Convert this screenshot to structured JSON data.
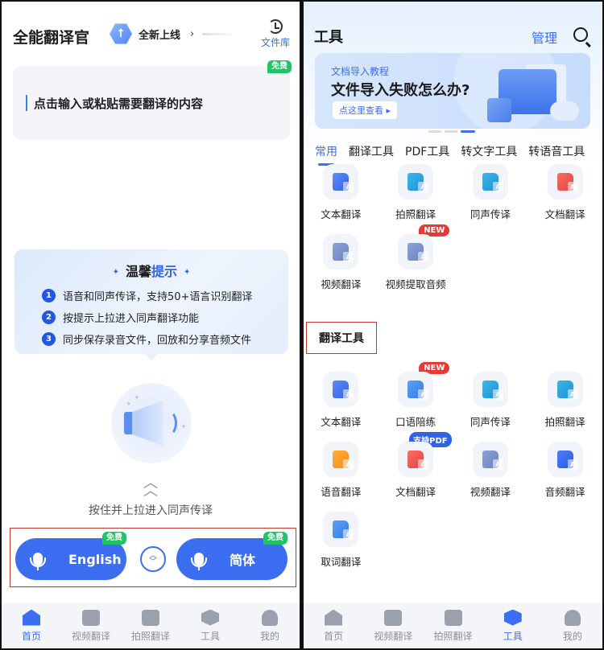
{
  "left": {
    "header": {
      "app_title": "全能翻译官",
      "new_launch": "全新上线",
      "file_library": "文件库"
    },
    "input": {
      "placeholder": "点击输入或粘贴需要翻译的内容",
      "badge": "免费"
    },
    "tips": {
      "title_plain": "温馨",
      "title_highlight": "提示",
      "items": [
        {
          "num": "1",
          "text": "语音和同声传译，支持50+语言识别翻译"
        },
        {
          "num": "2",
          "text": "按提示上拉进入同声翻译功能"
        },
        {
          "num": "3",
          "text": "同步保存录音文件，回放和分享音频文件"
        }
      ]
    },
    "hint": "按住并上拉进入同声传译",
    "languages": {
      "source": {
        "label": "English",
        "badge": "免费"
      },
      "target": {
        "label": "简体",
        "badge": "免费"
      }
    },
    "tabbar": [
      {
        "label": "首页",
        "icon": "home-icon",
        "active": true
      },
      {
        "label": "视频翻译",
        "icon": "video-icon",
        "active": false
      },
      {
        "label": "拍照翻译",
        "icon": "camera-icon",
        "active": false
      },
      {
        "label": "工具",
        "icon": "tools-icon",
        "active": false
      },
      {
        "label": "我的",
        "icon": "profile-icon",
        "active": false
      }
    ]
  },
  "right": {
    "header": {
      "title": "工具",
      "manage": "管理"
    },
    "banner": {
      "subtitle": "文档导入教程",
      "title": "文件导入失败怎么办?",
      "button": "点这里查看 ▸",
      "page_count": 3,
      "active_page": 3
    },
    "categories": [
      "常用",
      "翻译工具",
      "PDF工具",
      "转文字工具",
      "转语音工具"
    ],
    "active_category": "常用",
    "common_tools": [
      {
        "label": "文本翻译",
        "icon": "text-translate-icon"
      },
      {
        "label": "拍照翻译",
        "icon": "photo-translate-icon"
      },
      {
        "label": "同声传译",
        "icon": "simultaneous-interpretation-icon"
      },
      {
        "label": "文档翻译",
        "icon": "document-translate-icon"
      },
      {
        "label": "视频翻译",
        "icon": "video-translate-icon"
      },
      {
        "label": "视频提取音频",
        "icon": "video-extract-audio-icon",
        "badge": "NEW"
      }
    ],
    "translation_section_title": "翻译工具",
    "translation_tools": [
      {
        "label": "文本翻译",
        "icon": "text-translate-icon"
      },
      {
        "label": "口语陪练",
        "icon": "speaking-practice-icon",
        "badge": "NEW"
      },
      {
        "label": "同声传译",
        "icon": "simultaneous-interpretation-icon"
      },
      {
        "label": "拍照翻译",
        "icon": "photo-translate-icon"
      },
      {
        "label": "语音翻译",
        "icon": "voice-translate-icon"
      },
      {
        "label": "文档翻译",
        "icon": "document-translate-icon",
        "badge": "支持PDF"
      },
      {
        "label": "视频翻译",
        "icon": "video-translate-icon"
      },
      {
        "label": "音频翻译",
        "icon": "audio-translate-icon"
      },
      {
        "label": "取词翻译",
        "icon": "word-pick-translate-icon"
      }
    ],
    "tabbar": [
      {
        "label": "首页",
        "icon": "home-icon",
        "active": false
      },
      {
        "label": "视频翻译",
        "icon": "video-icon",
        "active": false
      },
      {
        "label": "拍照翻译",
        "icon": "camera-icon",
        "active": false
      },
      {
        "label": "工具",
        "icon": "tools-icon",
        "active": true
      },
      {
        "label": "我的",
        "icon": "profile-icon",
        "active": false
      }
    ]
  },
  "colors": {
    "accent": "#3b6ef0",
    "free_badge": "#22c266",
    "new_badge": "#e83a34",
    "highlight_box": "#c0392b"
  }
}
